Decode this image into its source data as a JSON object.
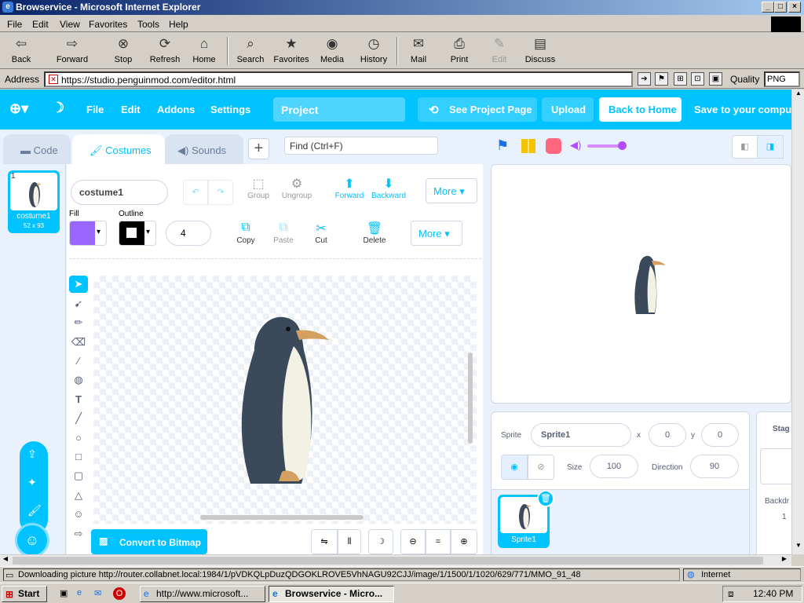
{
  "window": {
    "title": "Browservice - Microsoft Internet Explorer",
    "min": "_",
    "max": "□",
    "close": "×"
  },
  "menubar": [
    "File",
    "Edit",
    "View",
    "Favorites",
    "Tools",
    "Help"
  ],
  "toolbar": {
    "back": "Back",
    "forward": "Forward",
    "stop": "Stop",
    "refresh": "Refresh",
    "home": "Home",
    "search": "Search",
    "favorites": "Favorites",
    "media": "Media",
    "history": "History",
    "mail": "Mail",
    "print": "Print",
    "edit": "Edit",
    "discuss": "Discuss"
  },
  "address": {
    "label": "Address",
    "url": "https://studio.penguinmod.com/editor.html",
    "quality_label": "Quality",
    "quality_value": "PNG"
  },
  "app": {
    "menu": {
      "file": "File",
      "edit": "Edit",
      "addons": "Addons",
      "settings": "Settings",
      "project": "Project",
      "see_project": "See Project Page",
      "upload": "Upload",
      "back_home": "Back to Home",
      "save": "Save to your computer"
    },
    "tabs": {
      "code": "Code",
      "costumes": "Costumes",
      "sounds": "Sounds",
      "find_placeholder": "Find (Ctrl+F)"
    },
    "costume": {
      "index": "1",
      "name": "costume1",
      "size": "52 x 93"
    },
    "paint": {
      "name_value": "costume1",
      "group": "Group",
      "ungroup": "Ungroup",
      "forward": "Forward",
      "backward": "Backward",
      "more": "More",
      "fill_label": "Fill",
      "outline_label": "Outline",
      "outline_width": "4",
      "copy": "Copy",
      "paste": "Paste",
      "cut": "Cut",
      "delete": "Delete",
      "convert": "Convert to Bitmap",
      "fill_color": "#9966ff",
      "outline_color": "#000000"
    },
    "sprite": {
      "label": "Sprite",
      "name": "Sprite1",
      "x_label": "x",
      "x": "0",
      "y_label": "y",
      "y": "0",
      "size_label": "Size",
      "size": "100",
      "direction_label": "Direction",
      "direction": "90",
      "thumb_name": "Sprite1"
    },
    "stage_panel": {
      "label": "Stag",
      "backdrops_label": "Backdr",
      "count": "1"
    }
  },
  "status": {
    "message": "Downloading picture http://router.collabnet.local:1984/1/pVDKQLpDuzQDGOKLROVE5VhNAGU92CJJ/image/1/1500/1/1020/629/771/MMO_91_48",
    "zone": "Internet"
  },
  "taskbar": {
    "start": "Start",
    "task1": "http://www.microsoft...",
    "task2": "Browservice - Micro...",
    "clock": "12:40 PM"
  },
  "colors": {
    "accent": "#00c3ff",
    "title_bar": "#0a246a"
  }
}
